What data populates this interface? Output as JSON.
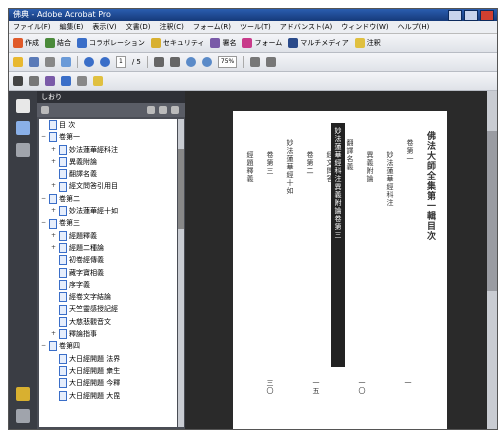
{
  "window": {
    "title": "佛典 - Adobe Acrobat Pro"
  },
  "menu": [
    "ファイル(F)",
    "編集(E)",
    "表示(V)",
    "文書(D)",
    "注釈(C)",
    "フォーム(R)",
    "ツール(T)",
    "アドバンスト(A)",
    "ウィンドウ(W)",
    "ヘルプ(H)"
  ],
  "toolbar1": {
    "create": "作成",
    "combine": "結合",
    "collab": "コラボレーション",
    "secure": "セキュリティ",
    "sign": "署名",
    "form": "フォーム",
    "multimedia": "マルチメディア",
    "comment": "注釈"
  },
  "toolbar2": {
    "page_field": "1",
    "page_total": "/ 5",
    "zoom": "75%"
  },
  "panel": {
    "title": "しおり",
    "items": [
      {
        "indent": 0,
        "exp": "",
        "label": "目 次"
      },
      {
        "indent": 0,
        "exp": "−",
        "label": "卷第一"
      },
      {
        "indent": 1,
        "exp": "+",
        "label": "妙法蓮華經科注"
      },
      {
        "indent": 1,
        "exp": "+",
        "label": "異義附論"
      },
      {
        "indent": 1,
        "exp": "",
        "label": "翻譯名義"
      },
      {
        "indent": 1,
        "exp": "+",
        "label": "經文問答引用目"
      },
      {
        "indent": 0,
        "exp": "−",
        "label": "卷第二"
      },
      {
        "indent": 1,
        "exp": "+",
        "label": "妙法蓮華經十如"
      },
      {
        "indent": 0,
        "exp": "−",
        "label": "卷第三"
      },
      {
        "indent": 1,
        "exp": "+",
        "label": "經題釋義"
      },
      {
        "indent": 1,
        "exp": "+",
        "label": "經題二種論"
      },
      {
        "indent": 1,
        "exp": "",
        "label": "初卷經傳義"
      },
      {
        "indent": 1,
        "exp": "",
        "label": "藏字寶相義"
      },
      {
        "indent": 1,
        "exp": "",
        "label": "序字義"
      },
      {
        "indent": 1,
        "exp": "",
        "label": "經卷文字結論"
      },
      {
        "indent": 1,
        "exp": "",
        "label": "天竺靈感授記經"
      },
      {
        "indent": 1,
        "exp": "",
        "label": "大慈悲觀音文"
      },
      {
        "indent": 1,
        "exp": "+",
        "label": "釋論指事"
      },
      {
        "indent": 0,
        "exp": "−",
        "label": "卷第四"
      },
      {
        "indent": 1,
        "exp": "",
        "label": "大日經開題 法界"
      },
      {
        "indent": 1,
        "exp": "",
        "label": "大日經開題 衆生"
      },
      {
        "indent": 1,
        "exp": "",
        "label": "大日經開題 今釋"
      },
      {
        "indent": 1,
        "exp": "",
        "label": "大日經開題 大毘"
      }
    ]
  },
  "page": {
    "title": "佛法大師全集第一輯目次",
    "columns": [
      "卷第一",
      "妙法蓮華經科注",
      "異義附論",
      "翻譯名義",
      "經文問答",
      "卷第二",
      "妙法蓮華經十如",
      "卷第三",
      "經題釋義"
    ],
    "highlight": "妙法蓮華經科注異義附論卷第三",
    "pages": [
      "一",
      "一〇",
      "一五",
      "三〇"
    ]
  }
}
